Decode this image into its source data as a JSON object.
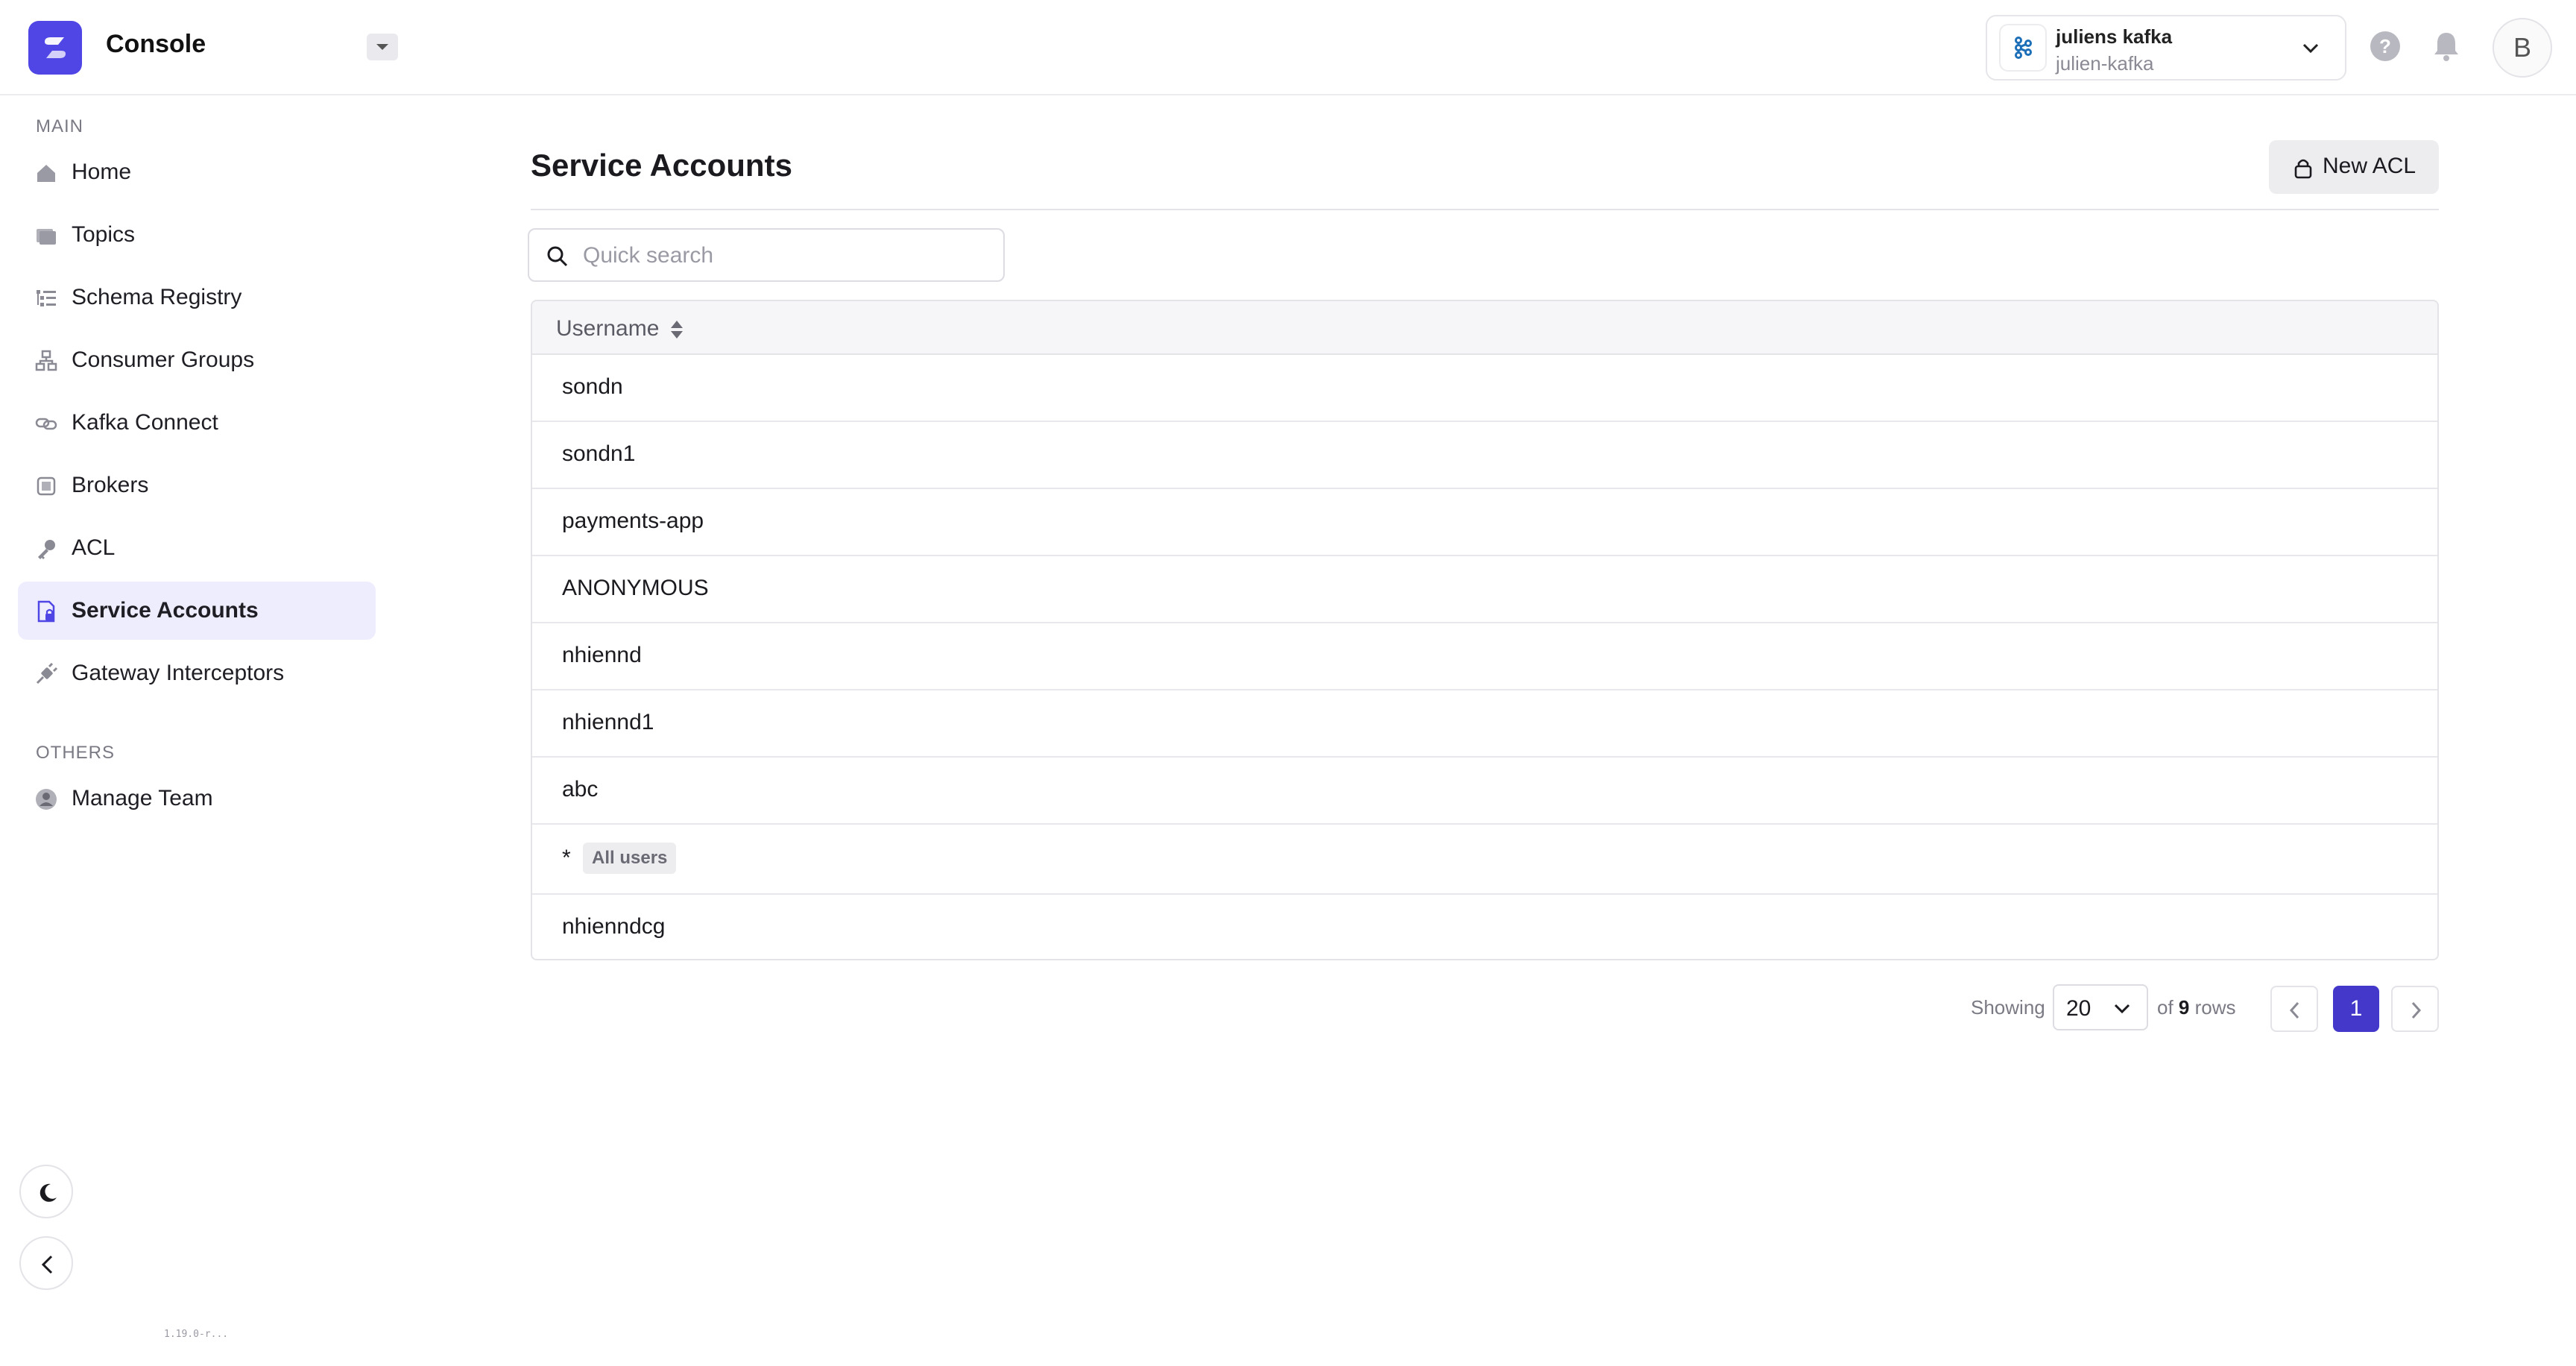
{
  "app": {
    "title": "Console"
  },
  "cluster": {
    "name": "juliens kafka",
    "id": "julien-kafka"
  },
  "user": {
    "initial": "B"
  },
  "sidebar": {
    "main_label": "MAIN",
    "others_label": "OTHERS",
    "items": [
      {
        "label": "Home",
        "icon": "home-icon"
      },
      {
        "label": "Topics",
        "icon": "topics-icon"
      },
      {
        "label": "Schema Registry",
        "icon": "schema-registry-icon"
      },
      {
        "label": "Consumer Groups",
        "icon": "consumer-groups-icon"
      },
      {
        "label": "Kafka Connect",
        "icon": "kafka-connect-icon"
      },
      {
        "label": "Brokers",
        "icon": "brokers-icon"
      },
      {
        "label": "ACL",
        "icon": "key-icon"
      },
      {
        "label": "Service Accounts",
        "icon": "service-accounts-icon",
        "active": true
      },
      {
        "label": "Gateway Interceptors",
        "icon": "plug-icon"
      }
    ],
    "others": [
      {
        "label": "Manage Team",
        "icon": "user-circle-icon"
      }
    ],
    "version": "1.19.0-r..."
  },
  "main": {
    "title": "Service Accounts",
    "new_acl_label": "New ACL",
    "search": {
      "placeholder": "Quick search",
      "value": ""
    },
    "table": {
      "column": "Username",
      "rows": [
        {
          "username": "sondn"
        },
        {
          "username": "sondn1"
        },
        {
          "username": "payments-app"
        },
        {
          "username": "ANONYMOUS"
        },
        {
          "username": "nhiennd"
        },
        {
          "username": "nhiennd1"
        },
        {
          "username": "abc"
        },
        {
          "username": "*",
          "tag": "All users"
        },
        {
          "username": "nhienndcg"
        }
      ]
    },
    "pagination": {
      "showing_label": "Showing",
      "page_size": "20",
      "of_label": "of",
      "total": "9",
      "rows_label": "rows",
      "current_page": "1"
    }
  },
  "colors": {
    "accent": "#4f46e5",
    "active_bg": "#eeedfd",
    "page_current": "#4338ca"
  }
}
